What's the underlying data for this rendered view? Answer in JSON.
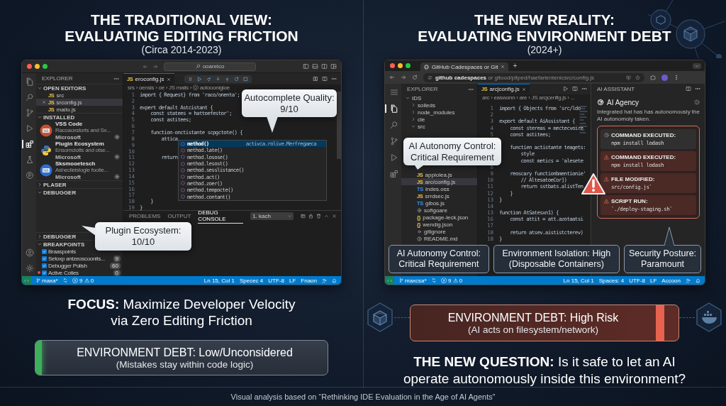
{
  "left": {
    "title": [
      "THE TRADITIONAL VIEW:",
      "EVALUATING EDITING FRICTION"
    ],
    "subtitle": "(Circa 2014-2023)",
    "ide": {
      "search": "ooareico",
      "activity_bar": [
        {
          "kind": "files",
          "selected": false
        },
        {
          "kind": "search",
          "selected": false
        },
        {
          "kind": "branch",
          "selected": false
        },
        {
          "kind": "run",
          "selected": false
        },
        {
          "kind": "extensions",
          "selected": true
        },
        {
          "kind": "flask",
          "selected": false
        },
        {
          "kind": "remote",
          "selected": false
        },
        {
          "kind": "account",
          "selected": false
        },
        {
          "kind": "settings",
          "selected": false
        }
      ],
      "sidebar": {
        "title": "EXPLORER",
        "sections": [
          {
            "kind": "files",
            "title": "OPEN EDITORS",
            "expanded": true,
            "items": [
              {
                "type_label": "JS",
                "name": "src",
                "selected": false
              },
              {
                "type_label": "JS",
                "name": "srconfig.js",
                "selected": true
              },
              {
                "type_label": "JS",
                "name": "mailo.js",
                "selected": false
              }
            ]
          },
          {
            "kind": "extensions",
            "title": "INSTALLED",
            "expanded": true,
            "items": [
              {
                "kind": "keyboard",
                "color": "#c9502e",
                "name": "VSS Code",
                "description": "Racoaoxstorts and Sx...",
                "publisher": "Microsoft"
              },
              {
                "kind": "snakes",
                "color": "#3b77a8",
                "name": "Plugin Ecosystem",
                "description": "Ensomciotts and otse...",
                "publisher": "Microsoft"
              },
              {
                "kind": "keyboard",
                "color": "#2a6fd8",
                "name": "Sksmooetesch",
                "description": "Ashecileistogle footie...",
                "publisher": "Microsoft"
              }
            ]
          },
          {
            "kind": "empty",
            "title": "PLASER",
            "expanded": false
          },
          {
            "kind": "empty",
            "title": "DEBUGGER",
            "expanded": true
          },
          {
            "kind": "empty",
            "title": "DEBUGGER",
            "expanded": false
          },
          {
            "kind": "breakpoints",
            "title": "BREAKPOINTS",
            "expanded": true,
            "items": [
              {
                "label": "Braaspoints",
                "checked": true,
                "marked": false
              },
              {
                "label": "Setoxp antzeoscoonits...",
                "count": "9",
                "checked": true,
                "marked": false
              },
              {
                "label": "Debugger Polish",
                "count": "60",
                "checked": true,
                "marked": false
              },
              {
                "label": "Active Cotles",
                "count": "0",
                "checked": true,
                "marked": true
              }
            ]
          }
        ]
      },
      "editor": {
        "tab": {
          "type_label": "JS",
          "name": "eroconfig.js"
        },
        "breadcrumb": "srs › oensis › oe › JS maiis › ⓪ aotooonigioe",
        "lines": [
          {
            "n": "1",
            "code": "import { Request} from 'raco/onenta';"
          },
          {
            "n": "2"
          },
          {
            "n": "3",
            "code": "expert default Astcistant {"
          },
          {
            "n": "4",
            "code": "    const statees = hattoefestor';"
          },
          {
            "n": "5",
            "code": "    const astitees;"
          },
          {
            "n": "6"
          },
          {
            "n": "7",
            "code": "    function-onctistante scpgctote() {"
          },
          {
            "n": "8",
            "code": "        attica"
          },
          {
            "n": "9"
          },
          {
            "n": "10"
          },
          {
            "n": "11",
            "code": "        return"
          },
          {
            "n": "12"
          },
          {
            "n": "13"
          },
          {
            "n": "14"
          },
          {
            "n": "15"
          },
          {
            "n": "16"
          },
          {
            "n": "17"
          },
          {
            "n": "18",
            "code": "    }"
          },
          {
            "n": "19",
            "code": "}"
          }
        ],
        "autocomplete": [
          {
            "label": "method()",
            "detail": "activca.rolive.Merfregaeca",
            "selected": true
          },
          {
            "label": "method.late()",
            "selected": false
          },
          {
            "label": "method.losose()",
            "selected": false
          },
          {
            "label": "method.lesost()",
            "selected": false
          },
          {
            "label": "method.sesslistance()",
            "selected": false
          },
          {
            "label": "method.act()",
            "selected": false
          },
          {
            "label": "method.zoer()",
            "selected": false
          },
          {
            "label": "method.tempocte()",
            "selected": false
          },
          {
            "label": "method.contant()",
            "selected": false
          }
        ]
      },
      "panel": {
        "tabs": [
          {
            "label": "PROBLEMS",
            "selected": false
          },
          {
            "label": "OUTPUT",
            "selected": false
          },
          {
            "label": "DEBUG CONSOLE",
            "selected": true
          }
        ],
        "terminal": "1. kach"
      },
      "status_left": [
        "maxa*",
        "ⓧ 9 ⚠ 0"
      ],
      "status_right": [
        "Ln 15, Col 1",
        "Specec 4",
        "UTF-8",
        "LF",
        "Fnaon"
      ],
      "callouts": [
        {
          "kind": "autocomplete",
          "label": "Autocomplete Quality:",
          "value": "9/10"
        },
        {
          "kind": "plugins",
          "label": "Plugin Ecosystem:",
          "value": "10/10"
        }
      ]
    },
    "focus": "**FOCUS:** Maximize Developer Velocity via Zero Editing Friction",
    "debt": {
      "kind": "low",
      "title": "ENVIRONMENT DEBT: Low/Unconsidered",
      "note": "(Mistakes stay within code logic)"
    }
  },
  "right": {
    "title": [
      "THE NEW REALITY:",
      "EVALUATING ENVIRONMENT DEBT"
    ],
    "subtitle": "(2024+)",
    "ide": {
      "tab": "GitHub Cadespaces or Git",
      "new_tab": "+",
      "url": "**github cadespaces** or gitood/pitped/haefarientenicsrc/config.js",
      "activity_bar": [
        {
          "kind": "menu",
          "selected": false
        },
        {
          "kind": "files",
          "selected": true
        },
        {
          "kind": "search",
          "selected": false
        },
        {
          "kind": "branch",
          "selected": false
        },
        {
          "kind": "run",
          "selected": false
        },
        {
          "kind": "extensions",
          "selected": false
        }
      ],
      "sidebar": {
        "title": "EXPLORER",
        "tree": [
          {
            "kind": "folder",
            "name": "IDS",
            "expanded": true,
            "selected": false,
            "children": [
              {
                "kind": "folder",
                "name": "solleds",
                "expanded": false,
                "selected": false
              },
              {
                "kind": "folder",
                "name": "node_modules",
                "expanded": false,
                "selected": false
              },
              {
                "kind": "folder",
                "name": "cle",
                "expanded": false,
                "selected": false
              },
              {
                "kind": "folder",
                "name": "src",
                "expanded": true,
                "selected": false,
                "children": [
                  {
                    "kind": "js",
                    "type_label": "JS",
                    "name": "appiolea.js",
                    "selected": false
                  },
                  {
                    "kind": "js",
                    "type_label": "JS",
                    "name": "arc/config.js",
                    "selected": true
                  },
                  {
                    "kind": "ts",
                    "type_label": "TS",
                    "name": "indes.oss",
                    "selected": false
                  },
                  {
                    "kind": "js",
                    "type_label": "JS",
                    "name": "srrdsec.js",
                    "selected": false
                  },
                  {
                    "kind": "ts",
                    "type_label": "TS",
                    "name": "gibos.js",
                    "selected": false
                  },
                  {
                    "kind": "config",
                    "name": "sofigoare",
                    "selected": false
                  },
                  {
                    "kind": "json",
                    "type_label": "{}",
                    "name": "package-leck.json",
                    "selected": false
                  },
                  {
                    "kind": "json",
                    "type_label": "{}",
                    "name": "wendig.json",
                    "selected": false
                  },
                  {
                    "kind": "ignore",
                    "name": "gitignore",
                    "selected": false
                  },
                  {
                    "kind": "readme",
                    "name": "README.md",
                    "selected": false
                  }
                ]
              }
            ]
          }
        ]
      },
      "editor": {
        "tab": {
          "type_label": "JS",
          "name": "arcjconfig.js"
        },
        "breadcrumb": "arc › easwonn › are › JS arcjcenfig.js › ...",
        "lines": [
          {
            "n": "1",
            "code": "import { Objects from 'src/ldo"
          },
          {
            "n": "2"
          },
          {
            "n": "3",
            "code": "export default AiAssistant {"
          },
          {
            "n": "4",
            "code": "    const stereas = mectecvoire"
          },
          {
            "n": "5",
            "code": "    const astitees;"
          },
          {
            "code": "    functien actistante teagets:",
            "blank_before": true
          },
          {
            "code": "        style"
          },
          {
            "code": "        const metics = 'alesete"
          },
          {
            "n": "8"
          },
          {
            "n": "9",
            "code": "    reoscary functionbmentionie'"
          },
          {
            "n": "10",
            "code": "        // AltesatoeCor])"
          },
          {
            "n": "11",
            "code": "        return sstbats.alistTen"
          },
          {
            "n": "12",
            "code": "    }"
          },
          {
            "n": "13",
            "code": "}"
          },
          {
            "n": "14"
          },
          {
            "n": "13",
            "code": "function AtSatesxn1) {"
          },
          {
            "n": "16",
            "code": "    const attit = att.azotaatsi"
          },
          {
            "n": "17"
          },
          {
            "n": "18",
            "code": "    return atsev.aististcterev)"
          },
          {
            "n": "18",
            "code": "}"
          }
        ]
      },
      "assistant": {
        "title": "AI ASSISTANT",
        "heading": "AI Agency",
        "description": "Integrated hat has has autonomously the AI autonomoly taken.",
        "log": [
          {
            "kind": "info",
            "title": "COMMAND EXECUTED:",
            "detail": "npm install lodash"
          },
          {
            "kind": "warning",
            "title": "COMMAND EXECUTED:",
            "detail": "npm install lodash"
          },
          {
            "kind": "warning",
            "title": "FILE MODIFIED:",
            "detail": "src/config.js`"
          },
          {
            "kind": "warning",
            "title": "SCRIPT RUN:",
            "detail": "`./deploy-staging.sh`"
          }
        ]
      },
      "status_left": [
        "maxcsa*",
        "ⓧ 9 ⚠ 0"
      ],
      "status_right": [
        "Ln 15, Col 1",
        "Spaces: 4",
        "UTF-8",
        "LF",
        "Accoon"
      ],
      "callouts": [
        {
          "kind": "sidebar",
          "label": "AI Autonomy Control:",
          "value": "Critical Requirement"
        }
      ],
      "criteria": [
        {
          "label": "AI Autonomy Control:",
          "value": "Critical Requirement",
          "pointer": false
        },
        {
          "label": "Environment Isolation: High",
          "value": "(Disposable Containers)",
          "pointer": false
        },
        {
          "label": "Security Posture:",
          "value": "Paramount",
          "pointer": true
        }
      ]
    },
    "debt": {
      "kind": "high",
      "title": "ENVIRONMENT DEBT: High Risk",
      "note": "(AI acts on filesystem/network)"
    },
    "question": "**THE NEW QUESTION:** Is it safe to let an AI operate autonomously inside this environment?"
  },
  "footer": "Visual analysis based on “Rethinking IDE Evaluation in the Age of AI Agents”"
}
